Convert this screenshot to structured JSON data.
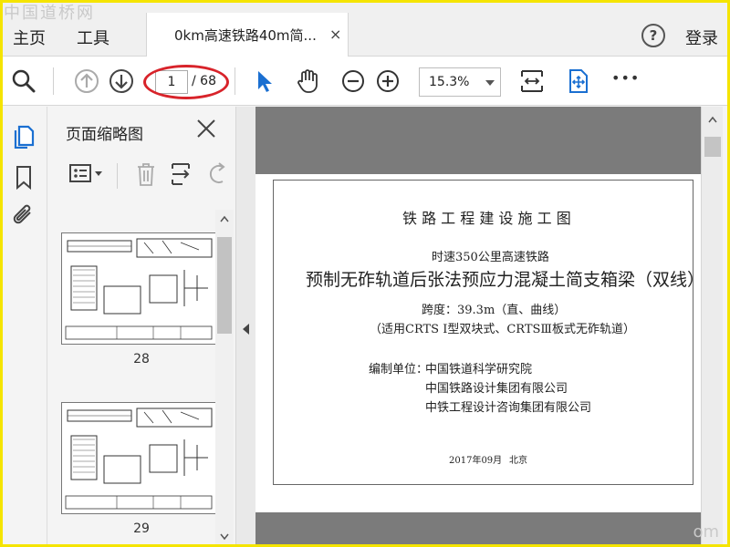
{
  "watermark": "中国道桥网",
  "watermark_corner": "om",
  "menubar": {
    "home_label": "主页",
    "tools_label": "工具",
    "tab_title": "0km高速铁路40m简...",
    "tab_close": "×",
    "help_glyph": "?",
    "login_label": "登录"
  },
  "toolbar": {
    "page_current": "1",
    "page_total": "/ 68",
    "zoom_value": "15.3%",
    "more_glyph": "•••"
  },
  "thumbnail_panel": {
    "title": "页面缩略图",
    "thumbnails": [
      {
        "page_label": "28"
      },
      {
        "page_label": "29"
      }
    ]
  },
  "document": {
    "heading": "铁 路 工 程 建 设 施 工 图",
    "subtitle": "时速350公里高速铁路",
    "title": "预制无砟轨道后张法预应力混凝土简支箱梁（双线）",
    "span": "跨度：39.3m（直、曲线）",
    "applicability": "（适用CRTS Ⅰ型双块式、CRTSⅢ板式无砟轨道）",
    "compiler_label": "编制单位：",
    "compilers": [
      "中国铁道科学研究院",
      "中国铁路设计集团有限公司",
      "中铁工程设计咨询集团有限公司"
    ],
    "date": "2017年09月",
    "city": "北京"
  },
  "colors": {
    "accent_blue": "#1a6fd1",
    "annotation_red": "#d8232a",
    "frame_yellow": "#f5e400"
  }
}
